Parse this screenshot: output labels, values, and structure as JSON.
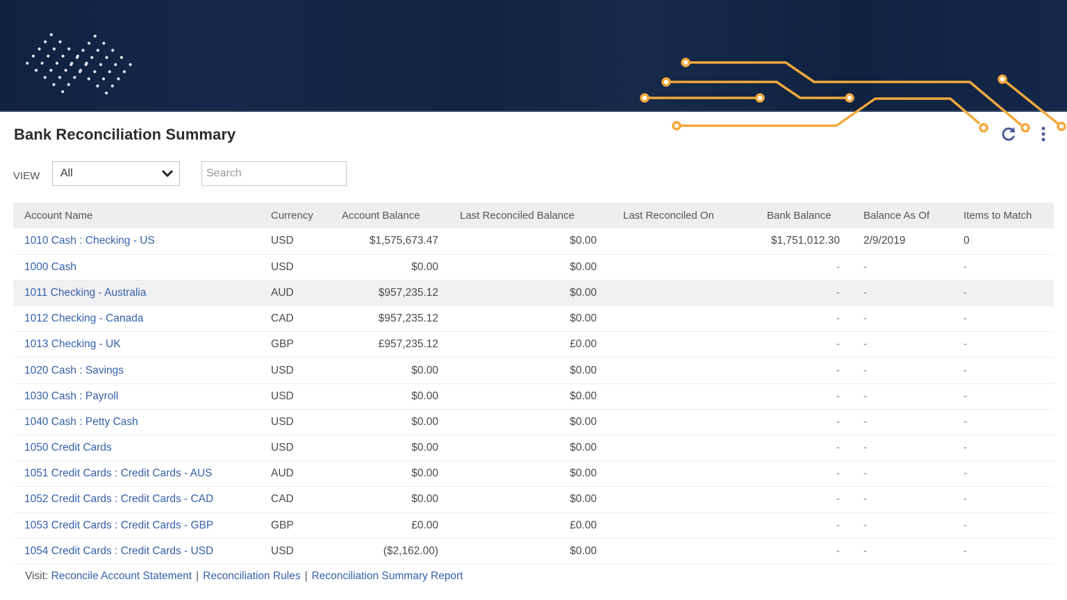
{
  "header": {
    "title": "Bank Reconciliation Summary",
    "refresh_icon": "refresh-icon",
    "more_icon": "more-vertical-icon"
  },
  "filters": {
    "view_label": "VIEW",
    "view_selected": "All",
    "search_placeholder": "Search",
    "search_value": ""
  },
  "table": {
    "columns": [
      "Account Name",
      "Currency",
      "Account Balance",
      "Last Reconciled Balance",
      "Last Reconciled On",
      "Bank Balance",
      "Balance As Of",
      "Items to Match"
    ],
    "rows": [
      {
        "account": "1010 Cash : Checking - US",
        "currency": "USD",
        "balance": "$1,575,673.47",
        "last_rec_balance": "$0.00",
        "last_rec_on": "",
        "bank_balance": "$1,751,012.30",
        "as_of": "2/9/2019",
        "items": "0"
      },
      {
        "account": "1000 Cash",
        "currency": "USD",
        "balance": "$0.00",
        "last_rec_balance": "$0.00",
        "last_rec_on": "",
        "bank_balance": "-",
        "as_of": "-",
        "items": "-"
      },
      {
        "account": "1011 Checking - Australia",
        "currency": "AUD",
        "balance": "$957,235.12",
        "last_rec_balance": "$0.00",
        "last_rec_on": "",
        "bank_balance": "-",
        "as_of": "-",
        "items": "-"
      },
      {
        "account": "1012 Checking - Canada",
        "currency": "CAD",
        "balance": "$957,235.12",
        "last_rec_balance": "$0.00",
        "last_rec_on": "",
        "bank_balance": "-",
        "as_of": "-",
        "items": "-"
      },
      {
        "account": "1013 Checking - UK",
        "currency": "GBP",
        "balance": "£957,235.12",
        "last_rec_balance": "£0.00",
        "last_rec_on": "",
        "bank_balance": "-",
        "as_of": "-",
        "items": "-"
      },
      {
        "account": "1020 Cash : Savings",
        "currency": "USD",
        "balance": "$0.00",
        "last_rec_balance": "$0.00",
        "last_rec_on": "",
        "bank_balance": "-",
        "as_of": "-",
        "items": "-"
      },
      {
        "account": "1030 Cash : Payroll",
        "currency": "USD",
        "balance": "$0.00",
        "last_rec_balance": "$0.00",
        "last_rec_on": "",
        "bank_balance": "-",
        "as_of": "-",
        "items": "-"
      },
      {
        "account": "1040 Cash : Petty Cash",
        "currency": "USD",
        "balance": "$0.00",
        "last_rec_balance": "$0.00",
        "last_rec_on": "",
        "bank_balance": "-",
        "as_of": "-",
        "items": "-"
      },
      {
        "account": "1050 Credit Cards",
        "currency": "USD",
        "balance": "$0.00",
        "last_rec_balance": "$0.00",
        "last_rec_on": "",
        "bank_balance": "-",
        "as_of": "-",
        "items": "-"
      },
      {
        "account": "1051 Credit Cards : Credit Cards - AUS",
        "currency": "AUD",
        "balance": "$0.00",
        "last_rec_balance": "$0.00",
        "last_rec_on": "",
        "bank_balance": "-",
        "as_of": "-",
        "items": "-"
      },
      {
        "account": "1052 Credit Cards : Credit Cards - CAD",
        "currency": "CAD",
        "balance": "$0.00",
        "last_rec_balance": "$0.00",
        "last_rec_on": "",
        "bank_balance": "-",
        "as_of": "-",
        "items": "-"
      },
      {
        "account": "1053 Credit Cards : Credit Cards - GBP",
        "currency": "GBP",
        "balance": "£0.00",
        "last_rec_balance": "£0.00",
        "last_rec_on": "",
        "bank_balance": "-",
        "as_of": "-",
        "items": "-"
      },
      {
        "account": "1054 Credit Cards : Credit Cards - USD",
        "currency": "USD",
        "balance": "($2,162.00)",
        "last_rec_balance": "$0.00",
        "last_rec_on": "",
        "bank_balance": "-",
        "as_of": "-",
        "items": "-"
      }
    ],
    "highlighted_row": 2
  },
  "footer": {
    "prefix": "Visit:",
    "links": [
      "Reconcile Account Statement",
      "Reconciliation Rules",
      "Reconciliation Summary Report"
    ],
    "separator": "|"
  },
  "colors": {
    "banner": "#11243f",
    "circuit_accent": "#f2a93b",
    "link": "#3560a8",
    "header_bg": "#eeeeee",
    "icon": "#4a5a9a"
  }
}
